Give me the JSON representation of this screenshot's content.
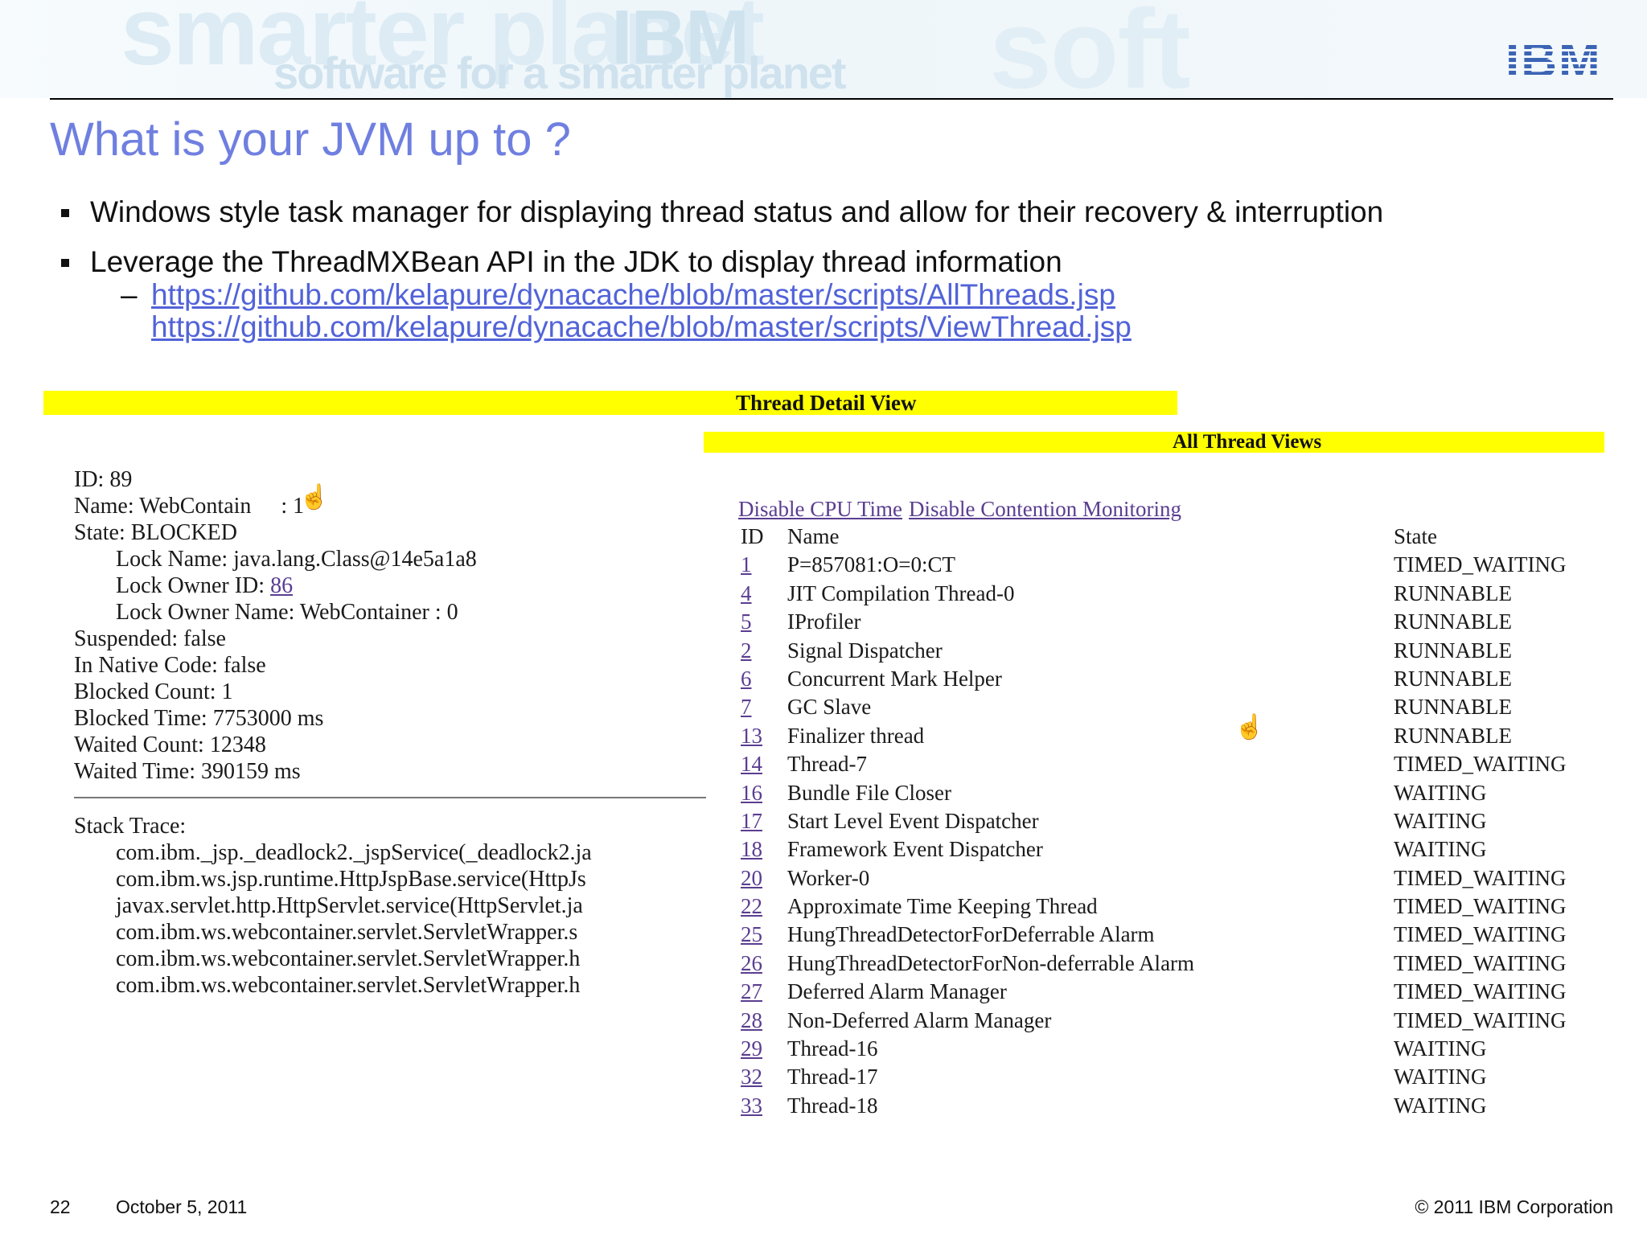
{
  "slide": {
    "banner_words": [
      "smarter planet",
      "software for a smarter planet",
      "soft",
      "IBM"
    ],
    "logo_text": "IBM",
    "title": "What is your JVM up to ?",
    "bullets": [
      "Windows style task manager for displaying thread status and allow for their recovery & interruption",
      "Leverage the ThreadMXBean API in the JDK to display thread information"
    ],
    "sub_dash": "–",
    "links": [
      "https://github.com/kelapure/dynacache/blob/master/scripts/AllThreads.jsp",
      "https://github.com/kelapure/dynacache/blob/master/scripts/ViewThread.jsp"
    ],
    "footer": {
      "page": "22",
      "date": "October 5, 2011",
      "copyright": "© 2011 IBM Corporation"
    }
  },
  "thread_detail": {
    "heading": "Thread Detail View",
    "id_line": "ID: 89",
    "name_line_a": "Name: WebContain",
    "name_line_b": " : 1",
    "state_line": "State: BLOCKED",
    "lock_name_line": "Lock Name: java.lang.Class@14e5a1a8",
    "lock_owner_label": "Lock Owner ID: ",
    "lock_owner_id": "86",
    "lock_owner_name_line": "Lock Owner Name: WebContainer : 0",
    "suspended_line": "Suspended: false",
    "native_line": "In Native Code: false",
    "blocked_count_line": "Blocked Count: 1",
    "blocked_time_line": "Blocked Time: 7753000 ms",
    "waited_count_line": "Waited Count: 12348",
    "waited_time_line": "Waited Time: 390159 ms",
    "stack_label": "Stack Trace:",
    "stack": [
      "com.ibm._jsp._deadlock2._jspService(_deadlock2.ja",
      "com.ibm.ws.jsp.runtime.HttpJspBase.service(HttpJs",
      "javax.servlet.http.HttpServlet.service(HttpServlet.ja",
      "com.ibm.ws.webcontainer.servlet.ServletWrapper.s",
      "com.ibm.ws.webcontainer.servlet.ServletWrapper.h",
      "com.ibm.ws.webcontainer.servlet.ServletWrapper.h"
    ]
  },
  "all_threads": {
    "heading": "All Thread Views",
    "link_cpu": "Disable CPU Time",
    "link_contention": "Disable Contention Monitoring",
    "col_id": "ID",
    "col_name": "Name",
    "col_state": "State",
    "rows": [
      {
        "id": "1",
        "name": "P=857081:O=0:CT",
        "state": "TIMED_WAITING"
      },
      {
        "id": "4",
        "name": "JIT Compilation Thread-0",
        "state": "RUNNABLE"
      },
      {
        "id": "5",
        "name": "IProfiler",
        "state": "RUNNABLE"
      },
      {
        "id": "2",
        "name": "Signal Dispatcher",
        "state": "RUNNABLE"
      },
      {
        "id": "6",
        "name": "Concurrent Mark Helper",
        "state": "RUNNABLE"
      },
      {
        "id": "7",
        "name": "GC Slave",
        "state": "RUNNABLE"
      },
      {
        "id": "13",
        "name": "Finalizer thread",
        "state": "RUNNABLE"
      },
      {
        "id": "14",
        "name": "Thread-7",
        "state": "TIMED_WAITING"
      },
      {
        "id": "16",
        "name": "Bundle File Closer",
        "state": "WAITING"
      },
      {
        "id": "17",
        "name": "Start Level Event Dispatcher",
        "state": "WAITING"
      },
      {
        "id": "18",
        "name": "Framework Event Dispatcher",
        "state": "WAITING"
      },
      {
        "id": "20",
        "name": "Worker-0",
        "state": "TIMED_WAITING"
      },
      {
        "id": "22",
        "name": "Approximate Time Keeping Thread",
        "state": "TIMED_WAITING"
      },
      {
        "id": "25",
        "name": "HungThreadDetectorForDeferrable Alarm",
        "state": "TIMED_WAITING"
      },
      {
        "id": "26",
        "name": "HungThreadDetectorForNon-deferrable Alarm",
        "state": "TIMED_WAITING"
      },
      {
        "id": "27",
        "name": "Deferred Alarm Manager",
        "state": "TIMED_WAITING"
      },
      {
        "id": "28",
        "name": "Non-Deferred Alarm Manager",
        "state": "TIMED_WAITING"
      },
      {
        "id": "29",
        "name": "Thread-16",
        "state": "WAITING"
      },
      {
        "id": "32",
        "name": "Thread-17",
        "state": "WAITING"
      },
      {
        "id": "33",
        "name": "Thread-18",
        "state": "WAITING"
      }
    ]
  },
  "colors": {
    "title": "#6f7fe0",
    "link": "#5263d8",
    "highlight": "#ffff00",
    "visited_link": "#5a3d90"
  },
  "icons": [
    "hand-pointer-cursor-icon",
    "bullet-square-icon"
  ]
}
